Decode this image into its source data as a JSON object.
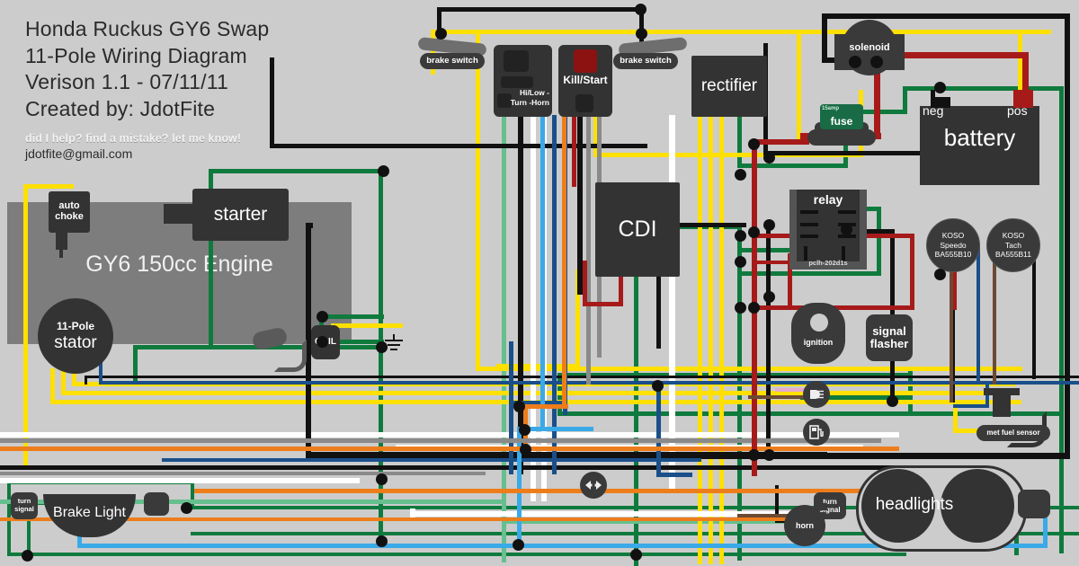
{
  "title": {
    "line1": "Honda Ruckus GY6 Swap",
    "line2": "11-Pole Wiring Diagram",
    "line3": "Verison 1.1 - 07/11/11",
    "line4": "Created by: JdotFite",
    "note": "did I help? find a mistake? let me know!",
    "email": "jdotfite@gmail.com"
  },
  "components": {
    "engine": "GY6 150cc Engine",
    "stator_top": "11-Pole",
    "stator_bottom": "stator",
    "starter": "starter",
    "auto_choke_l1": "auto",
    "auto_choke_l2": "choke",
    "coil": "COIL",
    "cdi": "CDI",
    "rectifier": "rectifier",
    "kill_start": "Kill/Start",
    "hilow_l1": "Hi/Low -",
    "hilow_l2": "Turn -Horn",
    "brake_switch_left": "brake switch",
    "brake_switch_right": "brake switch",
    "solenoid": "solenoid",
    "fuse": "fuse",
    "fuse_rating": "15amp",
    "battery": "battery",
    "battery_neg": "neg",
    "battery_pos": "pos",
    "relay": "relay",
    "relay_part": "pclh-202d1s",
    "koso_speedo_l1": "KOSO",
    "koso_speedo_l2": "Speedo",
    "koso_speedo_l3": "BA555B10",
    "koso_tach_l1": "KOSO",
    "koso_tach_l2": "Tach",
    "koso_tach_l3": "BA555B11",
    "ignition": "ignition",
    "signal_flasher_l1": "signal",
    "signal_flasher_l2": "flasher",
    "met_fuel_sensor": "met fuel sensor",
    "headlights": "headlights",
    "brake_light": "Brake Light",
    "turn_signal_front_l1": "turn",
    "turn_signal_front_l2": "signal",
    "turn_signal_rear_l1": "turn",
    "turn_signal_rear_l2": "signal",
    "horn": "horn"
  },
  "icons": {
    "high_beam": "high-beam-icon",
    "fuel": "fuel-gauge-icon",
    "turn_arrows": "turn-signal-arrows-icon",
    "ground": "ground-symbol-icon"
  },
  "colors": {
    "background": "#cccccc",
    "engine_block": "#7d7d7d",
    "component_body": "#333333",
    "wire_black": "#111111",
    "wire_red": "#a71a1a",
    "wire_green": "#0f7a3d",
    "wire_yellow": "#ffe000",
    "wire_white": "#ffffff",
    "wire_blue": "#1a4f8a",
    "wire_lightblue": "#3aa9e8",
    "wire_orange": "#ed7d1b",
    "wire_grey": "#8a8a8a",
    "wire_mint": "#66bf8e",
    "wire_brown": "#6b4a33",
    "wire_pink": "#e6a9cf",
    "kill_button": "#8c1212"
  },
  "chart_data": {
    "type": "diagram",
    "title": "Honda Ruckus GY6 Swap 11-Pole Wiring Diagram",
    "nodes": [
      "GY6 150cc Engine",
      "11-Pole stator",
      "starter",
      "auto choke",
      "COIL",
      "CDI",
      "rectifier",
      "Kill/Start",
      "Hi/Low - Turn -Horn",
      "brake switch",
      "solenoid",
      "fuse 15amp",
      "battery",
      "relay pclh-202d1s",
      "KOSO Speedo BA555B10",
      "KOSO Tach BA555B11",
      "ignition",
      "signal flasher",
      "met fuel sensor",
      "headlights",
      "Brake Light",
      "turn signal",
      "horn"
    ],
    "wire_colors": [
      "black",
      "red",
      "green",
      "yellow",
      "white",
      "blue",
      "light blue",
      "orange",
      "grey",
      "mint",
      "brown",
      "pink"
    ]
  }
}
